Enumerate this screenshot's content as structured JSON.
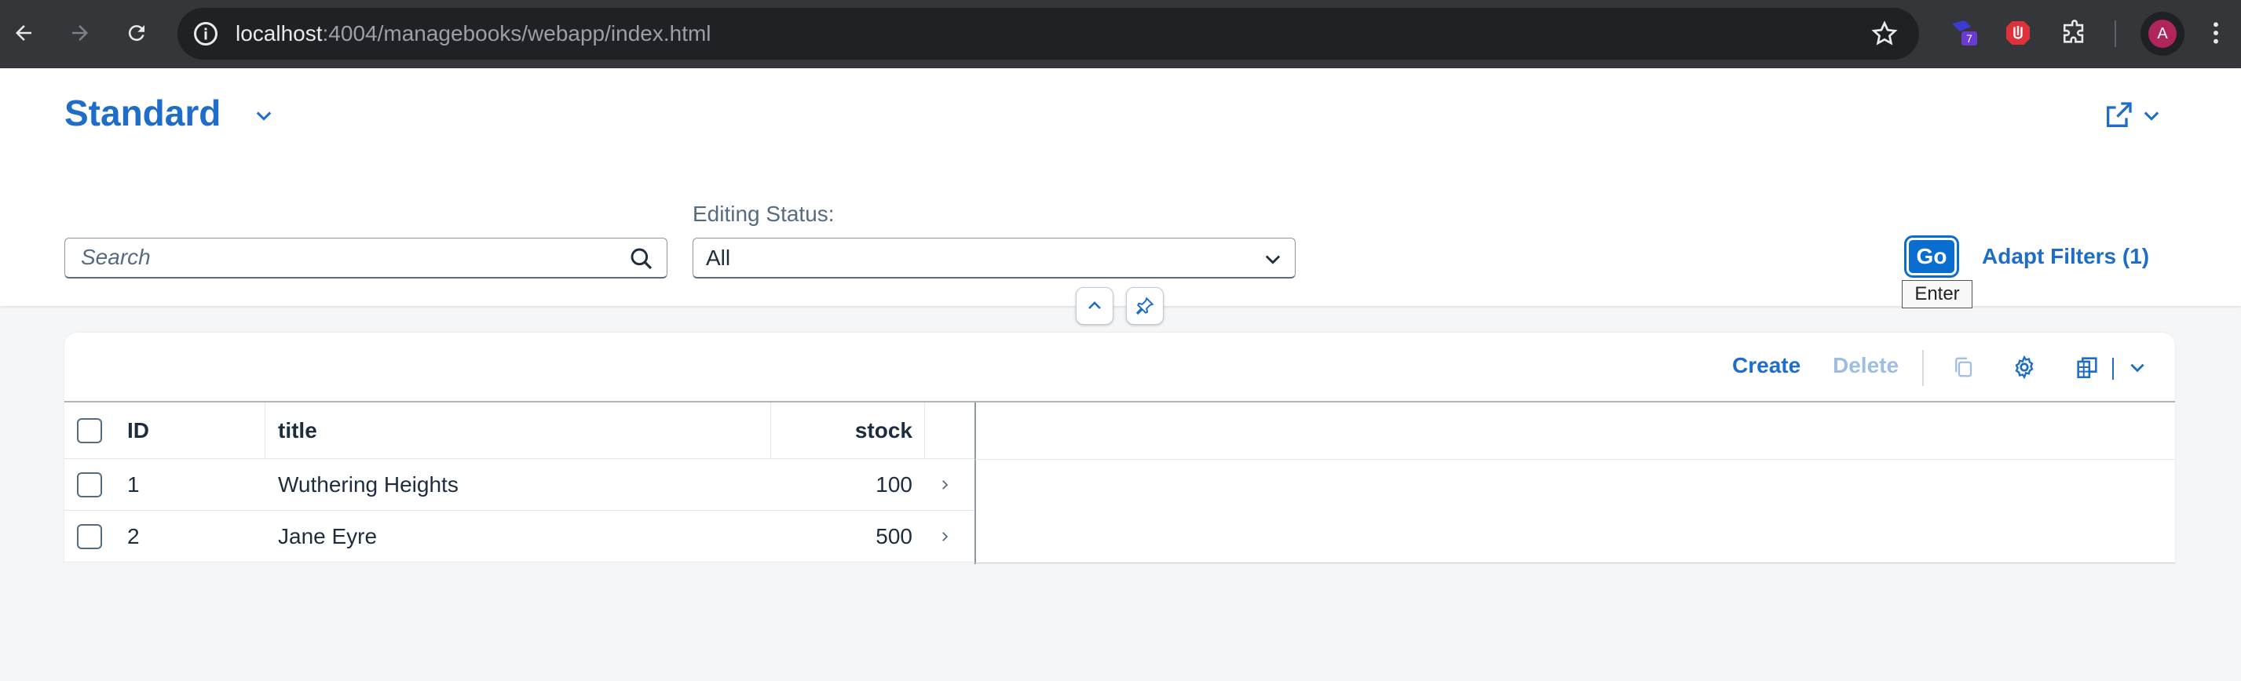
{
  "browser": {
    "url_host": "localhost",
    "url_path": ":4004/managebooks/webapp/index.html",
    "extension_badge": "7",
    "profile_initial": "A"
  },
  "header": {
    "variant_title": "Standard",
    "search_placeholder": "Search",
    "filter_label": "Editing Status:",
    "filter_value": "All",
    "go_label": "Go",
    "go_tooltip": "Enter",
    "adapt_filters_label": "Adapt Filters (1)"
  },
  "toolbar": {
    "create_label": "Create",
    "delete_label": "Delete"
  },
  "table": {
    "columns": [
      "ID",
      "title",
      "stock"
    ],
    "rows": [
      {
        "id": "1",
        "title": "Wuthering Heights",
        "stock": "100"
      },
      {
        "id": "2",
        "title": "Jane Eyre",
        "stock": "500"
      }
    ]
  },
  "colors": {
    "accent": "#1e6dc8",
    "primary_button": "#0a6ed1",
    "chrome": "#35363a"
  }
}
